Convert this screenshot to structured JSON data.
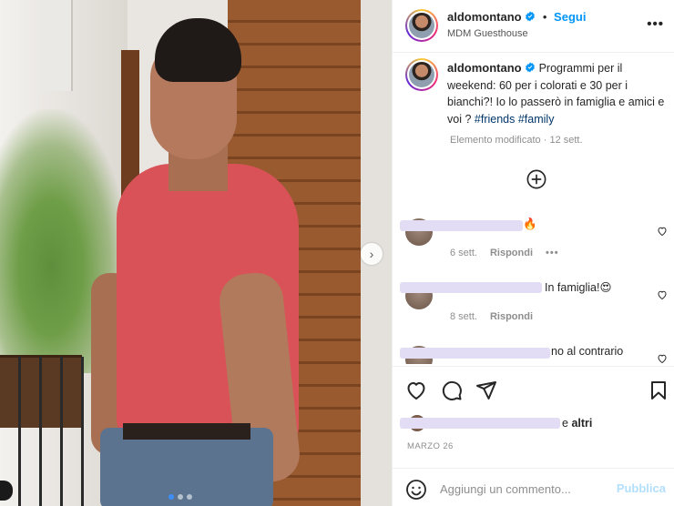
{
  "post": {
    "username": "aldomontano",
    "follow_label": "Segui",
    "separator": "•",
    "location": "MDM Guesthouse",
    "more_label": "•••"
  },
  "caption": {
    "username": "aldomontano",
    "text": "Programmi per il weekend: 60 per i colorati e 30 per i bianchi?! Io lo passerò in famiglia e amici e voi ?",
    "hashtags": [
      "#friends",
      "#family"
    ],
    "edited_label": "Elemento modificato",
    "dot": "·",
    "age": "12 sett."
  },
  "carousel": {
    "next_arrow": "›",
    "slide_count": 3,
    "active_slide": 1
  },
  "comments": [
    {
      "text": "🔥",
      "age": "6 sett.",
      "reply_label": "Rispondi",
      "more_label": "•••"
    },
    {
      "text": "In famiglia!😍",
      "age": "8 sett.",
      "reply_label": "Rispondi"
    },
    {
      "text": "no al contrario"
    }
  ],
  "likes": {
    "suffix": "e",
    "others": "altri"
  },
  "date": "MARZO 26",
  "add_comment": {
    "placeholder": "Aggiungi un commento...",
    "publish_label": "Pubblica"
  },
  "colors": {
    "accent": "#0095f6",
    "hashtag": "#00376b",
    "publish_disabled": "#b2dffc",
    "muted": "#8e8e8e",
    "redacted": "#e3dcf5"
  },
  "icons": {
    "verified": "verified-badge-icon",
    "add_circle": "plus-circle-icon",
    "like": "heart-icon",
    "comment": "comment-icon",
    "share": "paper-plane-icon",
    "save": "bookmark-icon",
    "emoji": "emoji-icon"
  }
}
